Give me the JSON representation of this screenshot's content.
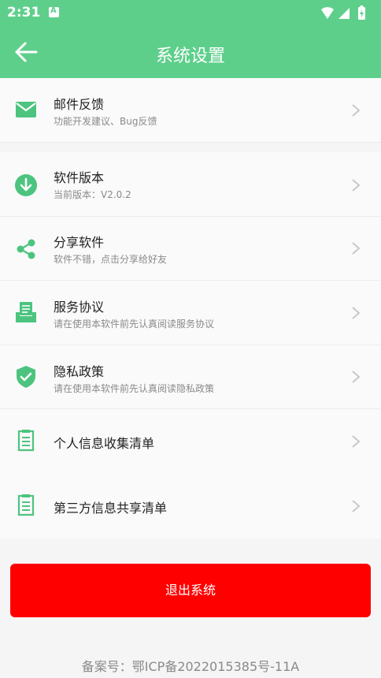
{
  "status_bar": {
    "time": "2:31"
  },
  "app_bar": {
    "title": "系统设置"
  },
  "items": [
    {
      "title": "邮件反馈",
      "subtitle": "功能开发建议、Bug反馈",
      "icon": "mail-icon"
    },
    {
      "title": "软件版本",
      "subtitle": "当前版本：V2.0.2",
      "icon": "download-icon"
    },
    {
      "title": "分享软件",
      "subtitle": "软件不错，点击分享给好友",
      "icon": "share-icon"
    },
    {
      "title": "服务协议",
      "subtitle": "请在使用本软件前先认真阅读服务协议",
      "icon": "document-icon"
    },
    {
      "title": "隐私政策",
      "subtitle": "请在使用本软件前先认真阅读隐私政策",
      "icon": "shield-check-icon"
    },
    {
      "title": "个人信息收集清单",
      "subtitle": "",
      "icon": "list-icon"
    },
    {
      "title": "第三方信息共享清单",
      "subtitle": "",
      "icon": "list-icon"
    }
  ],
  "logout_label": "退出系统",
  "icp": "备案号：鄂ICP备2022015385号-11A",
  "colors": {
    "primary": "#5ecf8b",
    "danger": "#ff0000"
  }
}
